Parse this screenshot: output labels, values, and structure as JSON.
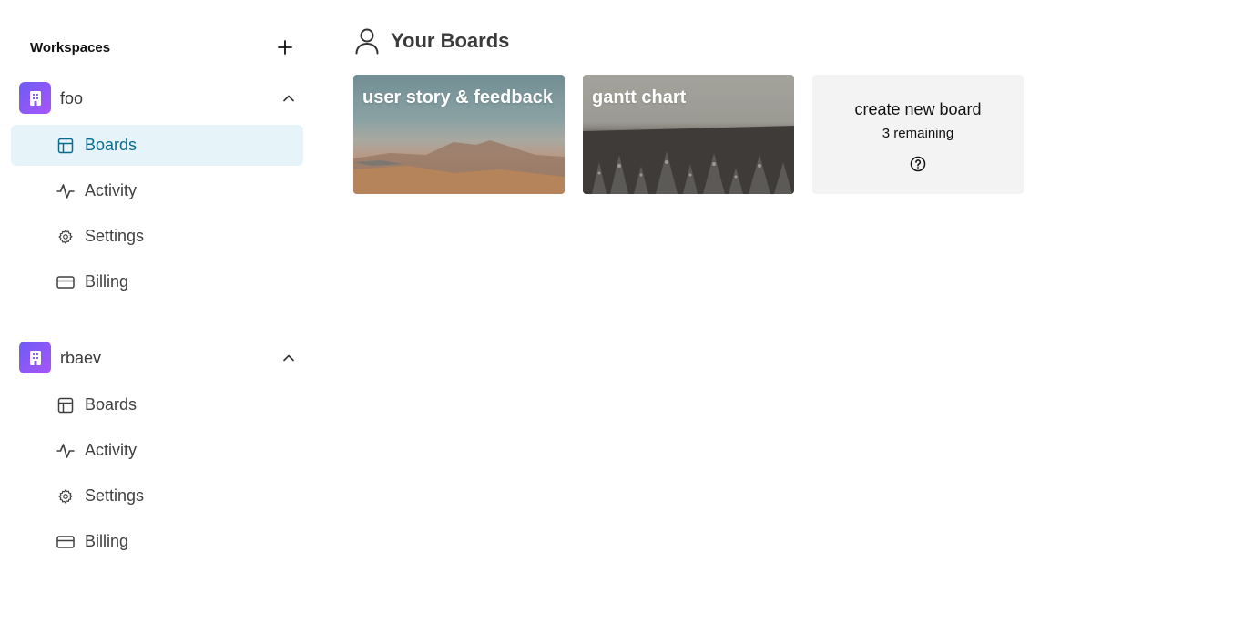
{
  "sidebar": {
    "header_label": "Workspaces",
    "workspaces": [
      {
        "name": "foo",
        "items": [
          {
            "label": "Boards",
            "icon": "layout-icon"
          },
          {
            "label": "Activity",
            "icon": "activity-icon"
          },
          {
            "label": "Settings",
            "icon": "gear-icon"
          },
          {
            "label": "Billing",
            "icon": "credit-card-icon"
          }
        ]
      },
      {
        "name": "rbaev",
        "items": [
          {
            "label": "Boards",
            "icon": "layout-icon"
          },
          {
            "label": "Activity",
            "icon": "activity-icon"
          },
          {
            "label": "Settings",
            "icon": "gear-icon"
          },
          {
            "label": "Billing",
            "icon": "credit-card-icon"
          }
        ]
      }
    ]
  },
  "main": {
    "title": "Your Boards",
    "boards": [
      {
        "title": "user story & feedback"
      },
      {
        "title": "gantt chart"
      }
    ],
    "create": {
      "label": "create new board",
      "remaining": "3 remaining"
    }
  },
  "colors": {
    "accent": "#0b6b8f",
    "active_bg": "#e6f4fa",
    "avatar_gradient_start": "#6d5cf6",
    "avatar_gradient_end": "#a855f7"
  }
}
